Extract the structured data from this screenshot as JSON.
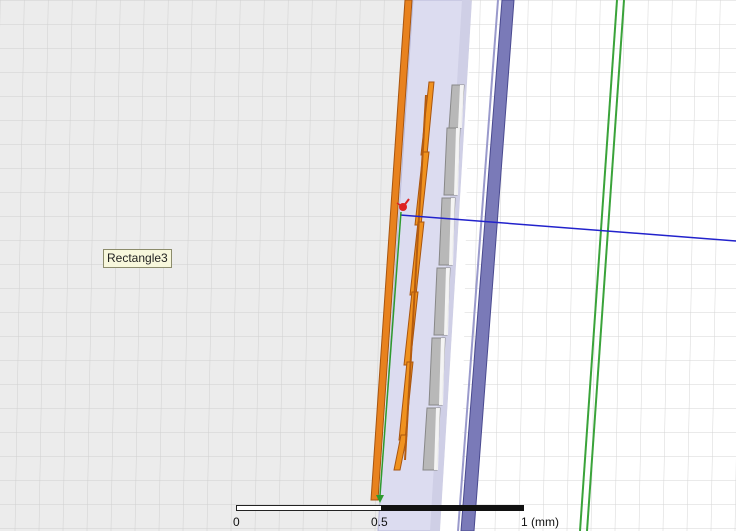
{
  "viewport": {
    "tooltip": "Rectangle3",
    "colors": {
      "background": "#ececec",
      "grid": "#cfcfcf",
      "substrate_band": "#dcdcee",
      "orange": "#e8821e",
      "gray_block": "#b4b4b4",
      "blue_line": "#2222cc",
      "green_line": "#3aa33a",
      "axis_red": "#dd2222"
    },
    "icons": [
      "coordinate-axes-icon"
    ]
  },
  "scale_ruler": {
    "tick_0": "0",
    "tick_mid": "0.5",
    "tick_end": "1 (mm)"
  }
}
